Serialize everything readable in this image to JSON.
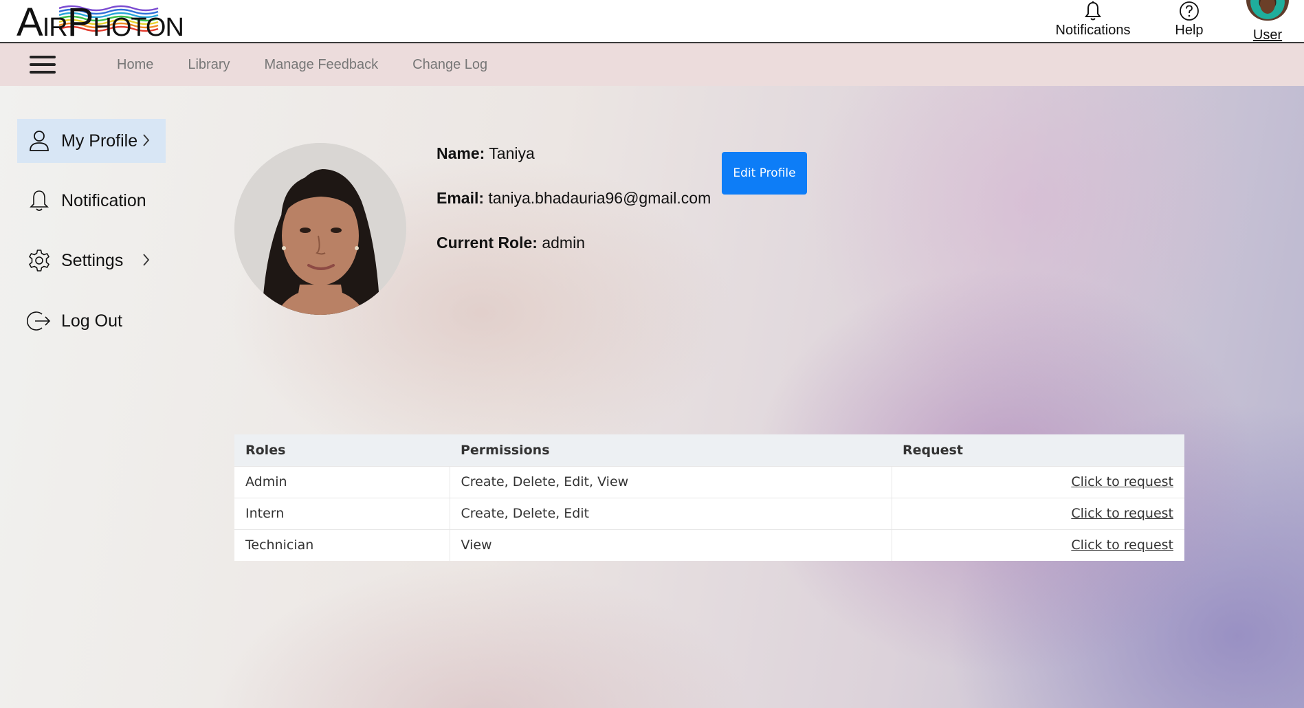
{
  "header": {
    "logo_text_a": "A",
    "logo_text_b": "IR",
    "logo_text_c": "P",
    "logo_text_d": "HOTON",
    "notifications_label": "Notifications",
    "help_label": "Help",
    "user_label": "User"
  },
  "nav": {
    "links": [
      "Home",
      "Library",
      "Manage Feedback",
      "Change Log"
    ]
  },
  "sidebar": {
    "items": [
      {
        "label": "My Profile",
        "icon": "user-icon",
        "active": true,
        "has_chevron": true
      },
      {
        "label": "Notification",
        "icon": "bell-icon",
        "active": false,
        "has_chevron": false
      },
      {
        "label": "Settings",
        "icon": "gear-icon",
        "active": false,
        "has_chevron": true
      },
      {
        "label": "Log Out",
        "icon": "logout-icon",
        "active": false,
        "has_chevron": false
      }
    ]
  },
  "profile": {
    "name_label": "Name:",
    "name_value": "Taniya",
    "email_label": "Email:",
    "email_value": "taniya.bhadauria96@gmail.com",
    "role_label": "Current Role:",
    "role_value": "admin",
    "edit_button": "Edit Profile"
  },
  "roles_table": {
    "headers": [
      "Roles",
      "Permissions",
      "Request"
    ],
    "rows": [
      {
        "role": "Admin",
        "permissions": "Create, Delete, Edit, View",
        "request": "Click to request"
      },
      {
        "role": "Intern",
        "permissions": "Create, Delete, Edit",
        "request": "Click to request"
      },
      {
        "role": "Technician",
        "permissions": "View",
        "request": "Click to request"
      }
    ]
  },
  "colors": {
    "accent_button": "#0d7df7",
    "nav_background": "#ecdcdc",
    "active_sidebar": "#d8e6f5"
  }
}
